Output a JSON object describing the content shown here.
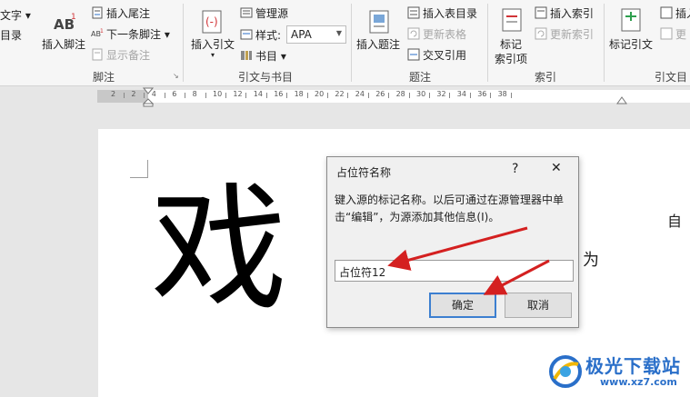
{
  "ribbon": {
    "footnotes_group": {
      "label": "脚注",
      "text_fragment": "文字",
      "text_fragment2": "目录",
      "insert_footnote": "插入脚注",
      "insert_endnote": "插入尾注",
      "next_footnote": "下一条脚注",
      "show_notes": "显示备注"
    },
    "citations_group": {
      "label": "引文与书目",
      "insert_citation": "插入引文",
      "manage_sources": "管理源",
      "style_label": "样式:",
      "style_value": "APA",
      "bibliography": "书目"
    },
    "captions_group": {
      "label": "题注",
      "insert_caption": "插入题注",
      "insert_table_of_figures": "插入表目录",
      "update_table": "更新表格",
      "cross_reference": "交叉引用"
    },
    "index_group": {
      "label": "索引",
      "mark_entry_line1": "标记",
      "mark_entry_line2": "索引项",
      "insert_index": "插入索引",
      "update_index": "更新索引"
    },
    "authorities_group": {
      "label": "引文目",
      "mark_citation": "标记引文",
      "insert_fragment": "插入",
      "update_fragment": "更"
    }
  },
  "ruler": {
    "numbers": [
      "2",
      "2",
      "4",
      "6",
      "8",
      "10",
      "12",
      "14",
      "16",
      "18",
      "20",
      "22",
      "24",
      "26",
      "28",
      "30",
      "32",
      "34",
      "36",
      "38"
    ]
  },
  "document": {
    "big_char": "戏",
    "side_text_1": "自",
    "side_text_2": "为"
  },
  "dialog": {
    "title": "占位符名称",
    "help": "?",
    "close": "✕",
    "message": "键入源的标记名称。以后可通过在源管理器中单击“编辑”，为源添加其他信息(I)。",
    "input_value": "占位符12",
    "ok": "确定",
    "cancel": "取消"
  },
  "colors": {
    "arrow": "#d42020",
    "ok_border": "#3c7fd0",
    "watermark": "#2a6fc9"
  },
  "watermark": {
    "text": "极光下载站",
    "url": "www.xz7.com"
  }
}
